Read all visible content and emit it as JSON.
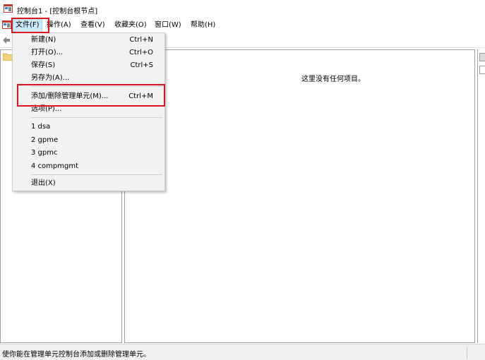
{
  "window": {
    "title": "控制台1 - [控制台根节点]"
  },
  "menubar": {
    "items": [
      {
        "label": "文件(F)",
        "active": true
      },
      {
        "label": "操作(A)"
      },
      {
        "label": "查看(V)"
      },
      {
        "label": "收藏夹(O)"
      },
      {
        "label": "窗口(W)"
      },
      {
        "label": "帮助(H)"
      }
    ]
  },
  "file_menu": {
    "items": [
      {
        "label": "新建(N)",
        "shortcut": "Ctrl+N"
      },
      {
        "label": "打开(O)...",
        "shortcut": "Ctrl+O"
      },
      {
        "label": "保存(S)",
        "shortcut": "Ctrl+S"
      },
      {
        "label": "另存为(A)...",
        "shortcut": ""
      },
      {
        "label": "添加/删除管理单元(M)...",
        "shortcut": "Ctrl+M",
        "highlighted": true
      },
      {
        "label": "选项(P)...",
        "shortcut": ""
      },
      {
        "label": "1 dsa",
        "shortcut": ""
      },
      {
        "label": "2 gpme",
        "shortcut": ""
      },
      {
        "label": "3 gpmc",
        "shortcut": ""
      },
      {
        "label": "4 compmgmt",
        "shortcut": ""
      },
      {
        "label": "退出(X)",
        "shortcut": ""
      }
    ]
  },
  "center_pane": {
    "empty_message": "这里没有任何项目。"
  },
  "statusbar": {
    "text": "使你能在管理单元控制台添加或删除管理单元。"
  },
  "icons": {
    "app": "mmc-console-icon",
    "back": "back-arrow-icon",
    "folder": "folder-icon"
  },
  "colors": {
    "highlight_border": "#e0141e",
    "menu_active_bg": "#cce8ff"
  }
}
